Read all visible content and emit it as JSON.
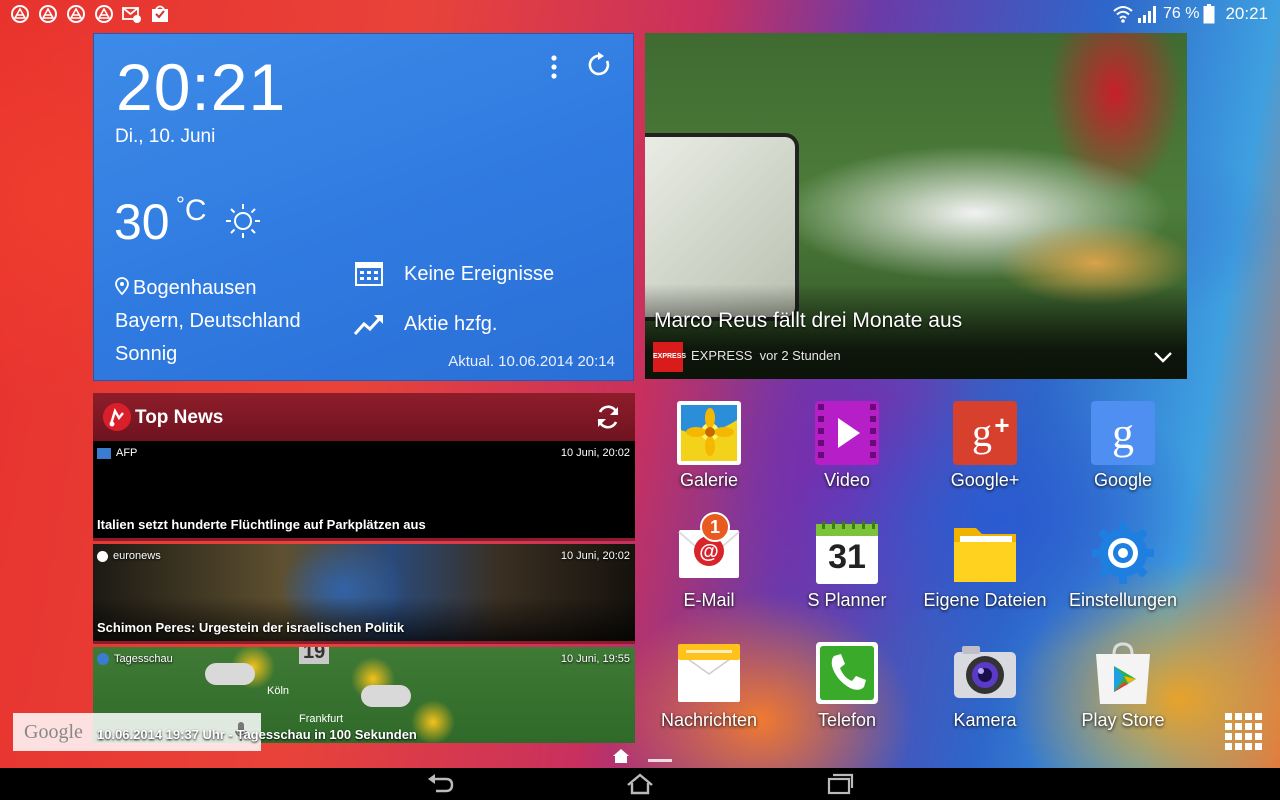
{
  "statusbar": {
    "battery": "76 %",
    "time": "20:21",
    "left_icons": [
      "notification-icon",
      "notification-icon",
      "notification-icon",
      "notification-icon",
      "mail-icon",
      "store-icon"
    ]
  },
  "weather_widget": {
    "time": "20:21",
    "date": "Di., 10. Juni",
    "temperature": "30",
    "unit": "C",
    "location": "Bogenhausen",
    "region": "Bayern, Deutschland",
    "condition": "Sonnig",
    "calendar_label": "Keine Ereignisse",
    "stocks_label": "Aktie hzfg.",
    "updated": "Aktual. 10.06.2014 20:14"
  },
  "news_photo_widget": {
    "headline": "Marco Reus fällt drei Monate aus",
    "source": "EXPRESS",
    "age": "vor 2 Stunden",
    "logo_text": "EXPRESS"
  },
  "top_news_widget": {
    "title": "Top News",
    "items": [
      {
        "source": "AFP",
        "time": "10 Juni, 20:02",
        "headline": "Italien setzt hunderte Flüchtlinge auf Parkplätzen aus"
      },
      {
        "source": "euronews",
        "time": "10 Juni, 20:02",
        "headline": "Schimon Peres: Urgestein der israelischen Politik"
      },
      {
        "source": "Tagesschau",
        "time": "10 Juni, 19:55",
        "headline": "10.06.2014 19:37 Uhr - Tagesschau in 100 Sekunden"
      }
    ],
    "map_labels": [
      "Köln",
      "Frankfurt",
      "19"
    ]
  },
  "google_search": {
    "logo": "Google"
  },
  "apps": [
    {
      "label": "Galerie",
      "icon": "gallery-icon"
    },
    {
      "label": "Video",
      "icon": "video-icon"
    },
    {
      "label": "Google+",
      "icon": "google-plus-icon"
    },
    {
      "label": "Google",
      "icon": "google-search-icon"
    },
    {
      "label": "E-Mail",
      "icon": "email-icon",
      "badge": "1"
    },
    {
      "label": "S Planner",
      "icon": "calendar-icon",
      "day": "31"
    },
    {
      "label": "Eigene Dateien",
      "icon": "folder-icon"
    },
    {
      "label": "Einstellungen",
      "icon": "settings-icon"
    },
    {
      "label": "Nachrichten",
      "icon": "messages-icon"
    },
    {
      "label": "Telefon",
      "icon": "phone-icon"
    },
    {
      "label": "Kamera",
      "icon": "camera-icon"
    },
    {
      "label": "Play Store",
      "icon": "play-store-icon"
    }
  ],
  "colors": {
    "weather_blue": "#2f7ae0",
    "news_red": "#8e1d2a",
    "badge_orange": "#e85a1f"
  }
}
